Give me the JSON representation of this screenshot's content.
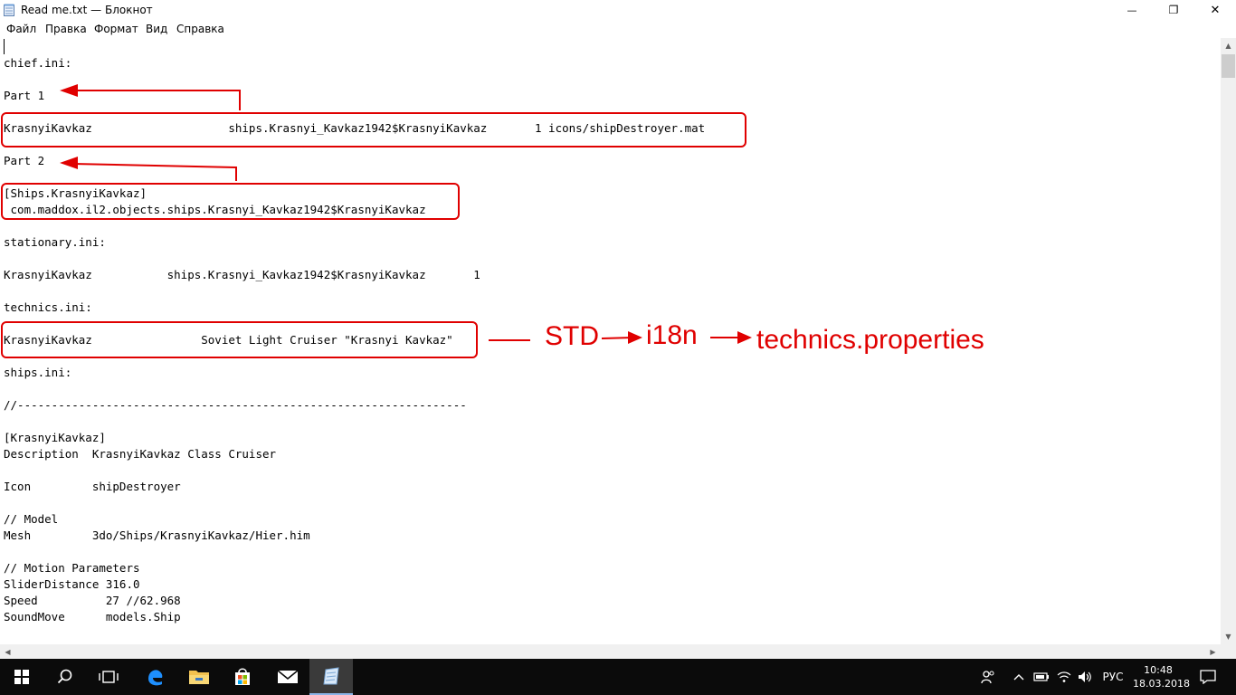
{
  "window": {
    "title": "Read me.txt — Блокнот",
    "minimize_glyph": "—",
    "maximize_glyph": "❐",
    "close_glyph": "✕"
  },
  "menu": [
    "Файл",
    "Правка",
    "Формат",
    "Вид",
    "Справка"
  ],
  "lines": [
    "",
    "chief.ini:",
    "",
    "Part 1",
    "",
    "KrasnyiKavkaz                    ships.Krasnyi_Kavkaz1942$KrasnyiKavkaz       1 icons/shipDestroyer.mat",
    "",
    "Part 2",
    "",
    "[Ships.KrasnyiKavkaz]",
    " com.maddox.il2.objects.ships.Krasnyi_Kavkaz1942$KrasnyiKavkaz",
    "",
    "stationary.ini:",
    "",
    "KrasnyiKavkaz           ships.Krasnyi_Kavkaz1942$KrasnyiKavkaz       1",
    "",
    "technics.ini:",
    "",
    "KrasnyiKavkaz                Soviet Light Cruiser \"Krasnyi Kavkaz\"",
    "",
    "ships.ini:",
    "",
    "//------------------------------------------------------------------",
    "",
    "[KrasnyiKavkaz]",
    "Description  KrasnyiKavkaz Class Cruiser",
    "",
    "Icon         shipDestroyer",
    "",
    "// Model",
    "Mesh         3do/Ships/KrasnyiKavkaz/Hier.him",
    "",
    "// Motion Parameters",
    "SliderDistance 316.0",
    "Speed          27 //62.968",
    "SoundMove      models.Ship"
  ],
  "annotation": {
    "color": "#e00000",
    "step1": "STD",
    "step2": "i18n",
    "step3": "technics.properties"
  },
  "taskbar": {
    "lang": "РУС",
    "time": "10:48",
    "date": "18.03.2018",
    "bg": "#0b0b0b"
  }
}
